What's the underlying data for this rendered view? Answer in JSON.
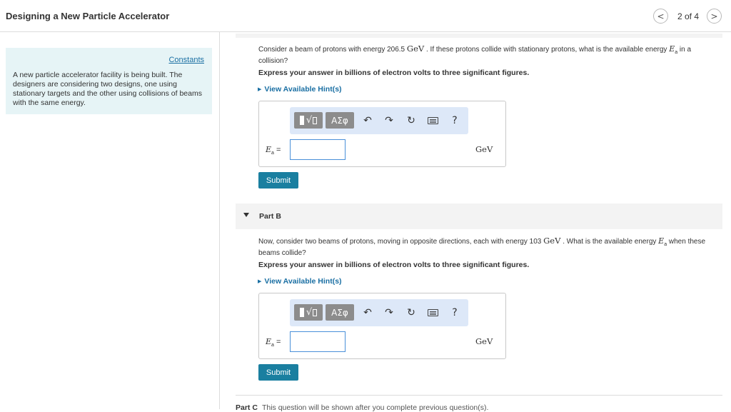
{
  "header": {
    "title": "Designing a New Particle Accelerator",
    "prev_icon": "<",
    "next_icon": ">",
    "page_count": "2 of 4"
  },
  "sidebar": {
    "constants_link": "Constants",
    "intro": "A new particle accelerator facility is being built. The designers are considering two designs, one using stationary targets and the other using collisions of beams with the same energy."
  },
  "toolbar_labels": {
    "greek": "ΑΣφ",
    "undo": "↶",
    "redo": "↷",
    "reset": "↻",
    "help": "?"
  },
  "part_a": {
    "q_pre": "Consider a beam of protons with energy 206.5 ",
    "q_unit": "GeV",
    "q_mid": " . If these protons collide with stationary protons, what is the available energy ",
    "q_var": "E",
    "q_sub": "a",
    "q_post": " in a collision?",
    "instruction": "Express your answer in billions of electron volts to three significant figures.",
    "hint": "View Available Hint(s)",
    "answer_var": "E",
    "answer_sub": "a",
    "answer_eq": " =",
    "answer_value": "",
    "unit": "GeV",
    "submit": "Submit"
  },
  "part_b": {
    "label": "Part B",
    "q_pre": "Now, consider two beams of protons, moving in opposite directions, each with energy 103 ",
    "q_unit": "GeV",
    "q_mid": " . What is the available energy ",
    "q_var": "E",
    "q_sub": "a",
    "q_post": " when these beams collide?",
    "instruction": "Express your answer in billions of electron volts to three significant figures.",
    "hint": "View Available Hint(s)",
    "answer_var": "E",
    "answer_sub": "a",
    "answer_eq": " =",
    "answer_value": "",
    "unit": "GeV",
    "submit": "Submit"
  },
  "part_c": {
    "label": "Part C",
    "text": "This question will be shown after you complete previous question(s)."
  },
  "colors": {
    "accent_blue": "#1a6fa3",
    "submit_bg": "#1a7fa0",
    "sidebar_bg": "#e6f4f6",
    "toolbar_bg": "#dde8f8"
  }
}
